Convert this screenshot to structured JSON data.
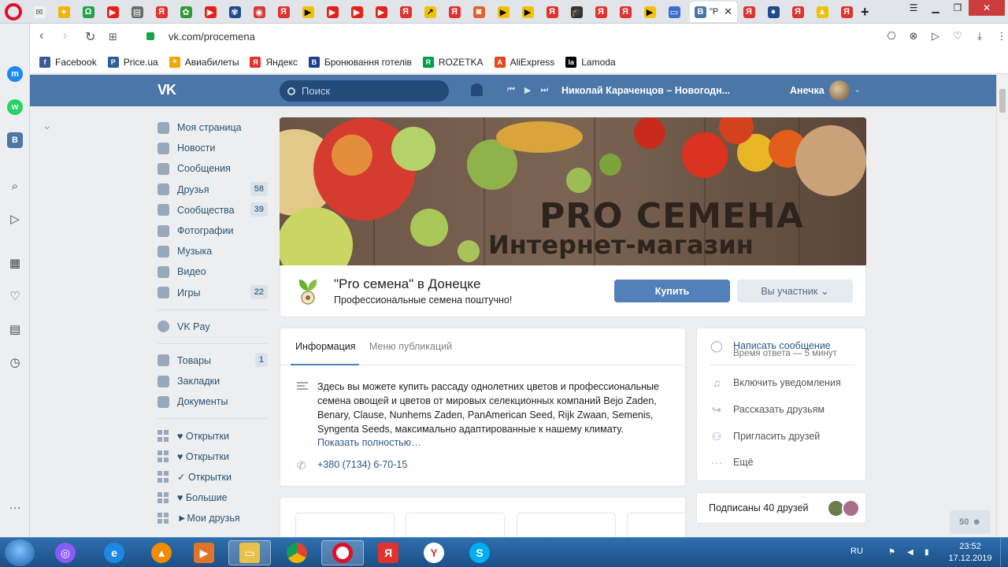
{
  "browser": {
    "url": "vk.com/procemena",
    "active_tab_label": "\"P",
    "tab_close": "✕",
    "tab_add": "+",
    "bookmarks": [
      {
        "label": "Facebook",
        "icon": "facebook-icon",
        "color": "#3b5998",
        "glyph": "f"
      },
      {
        "label": "Price.ua",
        "icon": "price-icon",
        "color": "#2e5b9c",
        "glyph": "P"
      },
      {
        "label": "Авиабилеты",
        "icon": "plane-icon",
        "color": "#f0a500",
        "glyph": "✈"
      },
      {
        "label": "Яндекс",
        "icon": "yandex-icon",
        "color": "#e0322f",
        "glyph": "Я"
      },
      {
        "label": "Бронювання готелів",
        "icon": "booking-icon",
        "color": "#1e3f8c",
        "glyph": "B"
      },
      {
        "label": "ROZETKA",
        "icon": "rozetka-icon",
        "color": "#00a046",
        "glyph": "R"
      },
      {
        "label": "AliExpress",
        "icon": "aliexpress-icon",
        "color": "#e6471f",
        "glyph": "A"
      },
      {
        "label": "Lamoda",
        "icon": "lamoda-icon",
        "color": "#000000",
        "glyph": "la"
      }
    ]
  },
  "vk": {
    "search_placeholder": "Поиск",
    "track": "Николай Караченцов – Новогодн...",
    "user_name": "Анечка",
    "nav": [
      {
        "label": "Моя страница",
        "icon": "home-icon",
        "count": ""
      },
      {
        "label": "Новости",
        "icon": "news-icon",
        "count": ""
      },
      {
        "label": "Сообщения",
        "icon": "messages-icon",
        "count": ""
      },
      {
        "label": "Друзья",
        "icon": "friends-icon",
        "count": "58"
      },
      {
        "label": "Сообщества",
        "icon": "communities-icon",
        "count": "39"
      },
      {
        "label": "Фотографии",
        "icon": "photos-icon",
        "count": ""
      },
      {
        "label": "Музыка",
        "icon": "music-icon",
        "count": ""
      },
      {
        "label": "Видео",
        "icon": "video-icon",
        "count": ""
      },
      {
        "label": "Игры",
        "icon": "games-icon",
        "count": "22"
      }
    ],
    "nav_pay": {
      "label": "VK Pay",
      "icon": "vkpay-icon"
    },
    "nav_extra": [
      {
        "label": "Товары",
        "icon": "goods-icon",
        "count": "1"
      },
      {
        "label": "Закладки",
        "icon": "bookmarks-icon",
        "count": ""
      },
      {
        "label": "Документы",
        "icon": "documents-icon",
        "count": ""
      }
    ],
    "nav_apps": [
      {
        "label": "♥ Открытки"
      },
      {
        "label": "♥ Открытки"
      },
      {
        "label": "✓ Открытки"
      },
      {
        "label": "♥ Большие"
      },
      {
        "label": "►Мои друзья"
      }
    ],
    "cover": {
      "title": "PRO СЕМЕНА",
      "subtitle": "Интернет-магазин"
    },
    "group": {
      "title": "\"Pro семена\" в Донецке",
      "status": "Профессиональные семена поштучно!",
      "buy_label": "Купить",
      "member_label": "Вы участник"
    },
    "info": {
      "tab_info": "Информация",
      "tab_menu": "Меню публикаций",
      "description": "Здесь вы можете купить рассаду однолетних цветов и профессиональные семена овощей и цветов от мировых селекционных компаний Bejo Zaden, Benary, Clause, Nunhems Zaden, PanAmerican Seed, Rijk Zwaan, Semenis, Syngenta Seeds, максимально адаптированные к нашему климату.",
      "show_more": "Показать полностью…",
      "phone": "+380 (7134) 6-70-15"
    },
    "actions": {
      "write": "Написать сообщение",
      "response": "Время ответа — 5 минут",
      "notify": "Включить уведомления",
      "share": "Рассказать друзьям",
      "invite": "Пригласить друзей",
      "more": "Ещё"
    },
    "friends_sub": "Подписаны 40 друзей",
    "chat_count": "50"
  },
  "taskbar": {
    "lang": "RU",
    "time": "23:52",
    "date": "17.12.2019"
  },
  "colors": {
    "vk_blue": "#4a76a8",
    "button_blue": "#5181b8",
    "link": "#2a5885"
  }
}
